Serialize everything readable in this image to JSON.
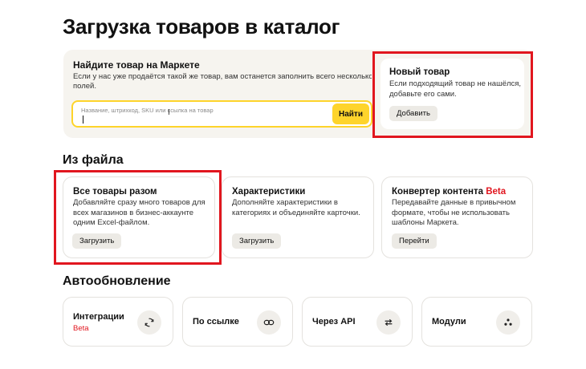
{
  "page": {
    "title": "Загрузка товаров в каталог"
  },
  "search": {
    "title": "Найдите товар на Маркете",
    "description_line1": "Если у нас уже продаётся такой же товар, вам останется заполнить всего несколько",
    "description_line2": "полей.",
    "placeholder": "Название, штрихкод, SKU или ссылка на товар",
    "value": "",
    "button_label": "Найти"
  },
  "new_product": {
    "title": "Новый товар",
    "description": "Если подходящий товар не нашёлся, добавьте его сами.",
    "button_label": "Добавить"
  },
  "from_file": {
    "heading": "Из файла",
    "cards": [
      {
        "title": "Все товары разом",
        "badge": "",
        "description": "Добавляйте сразу много товаров для всех магазинов в бизнес-аккаунте одним Excel-файлом.",
        "button_label": "Загрузить"
      },
      {
        "title": "Характеристики",
        "badge": "",
        "description": "Дополняйте характеристики в категориях и объединяйте карточки.",
        "button_label": "Загрузить"
      },
      {
        "title": "Конвертер контента",
        "badge": "Beta",
        "description": "Передавайте данные в привычном формате, чтобы не использовать шаблоны Маркета.",
        "button_label": "Перейти"
      }
    ]
  },
  "auto_update": {
    "heading": "Автообновление",
    "cards": [
      {
        "label": "Интеграции",
        "badge": "Beta",
        "icon": "sync-icon"
      },
      {
        "label": "По ссылке",
        "badge": "",
        "icon": "link-icon"
      },
      {
        "label": "Через API",
        "badge": "",
        "icon": "api-arrows-icon"
      },
      {
        "label": "Модули",
        "badge": "",
        "icon": "modules-dots-icon"
      }
    ]
  },
  "colors": {
    "accent_yellow": "#fed42b",
    "highlight_red": "#e1161f",
    "panel_bg": "#f6f4ef",
    "button_grey": "#eceae5"
  }
}
